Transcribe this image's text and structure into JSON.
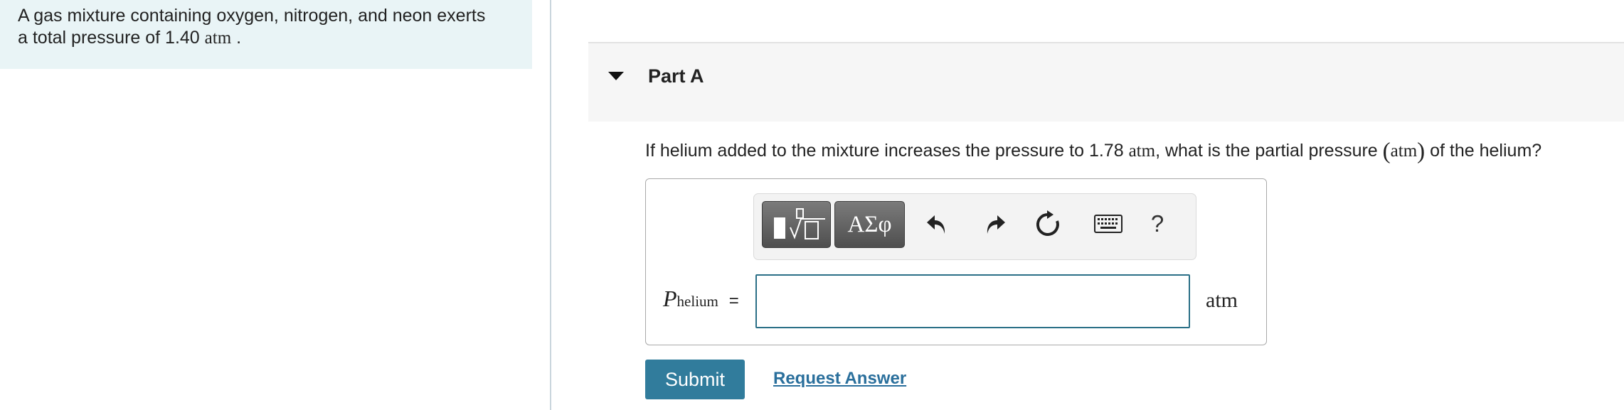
{
  "intro": {
    "line1": "A gas mixture containing oxygen, nitrogen, and neon exerts",
    "line2_prefix": "a total pressure of 1.40",
    "line2_unit": "atm",
    "line2_suffix": "."
  },
  "part": {
    "title": "Part A"
  },
  "question": {
    "part1": "If helium added to the mixture increases the pressure to 1.78",
    "unit1": "atm",
    "part2": ", what is the partial pressure",
    "paren_open": "(",
    "unit2": "atm",
    "paren_close": ")",
    "part3": "of the helium?"
  },
  "toolbar": {
    "symbols_label": "ΑΣφ",
    "help_label": "?",
    "icons": [
      "templates-icon",
      "undo-icon",
      "redo-icon",
      "reset-icon",
      "keyboard-icon",
      "help-icon"
    ]
  },
  "answer": {
    "label_main": "P",
    "label_sub": "helium",
    "equals": "=",
    "value": "",
    "unit": "atm"
  },
  "actions": {
    "submit_label": "Submit",
    "request_label": "Request Answer"
  },
  "colors": {
    "intro_bg": "#e9f4f6",
    "submit_bg": "#317c9c",
    "link": "#2a6f9c",
    "input_border": "#2a6f86"
  }
}
